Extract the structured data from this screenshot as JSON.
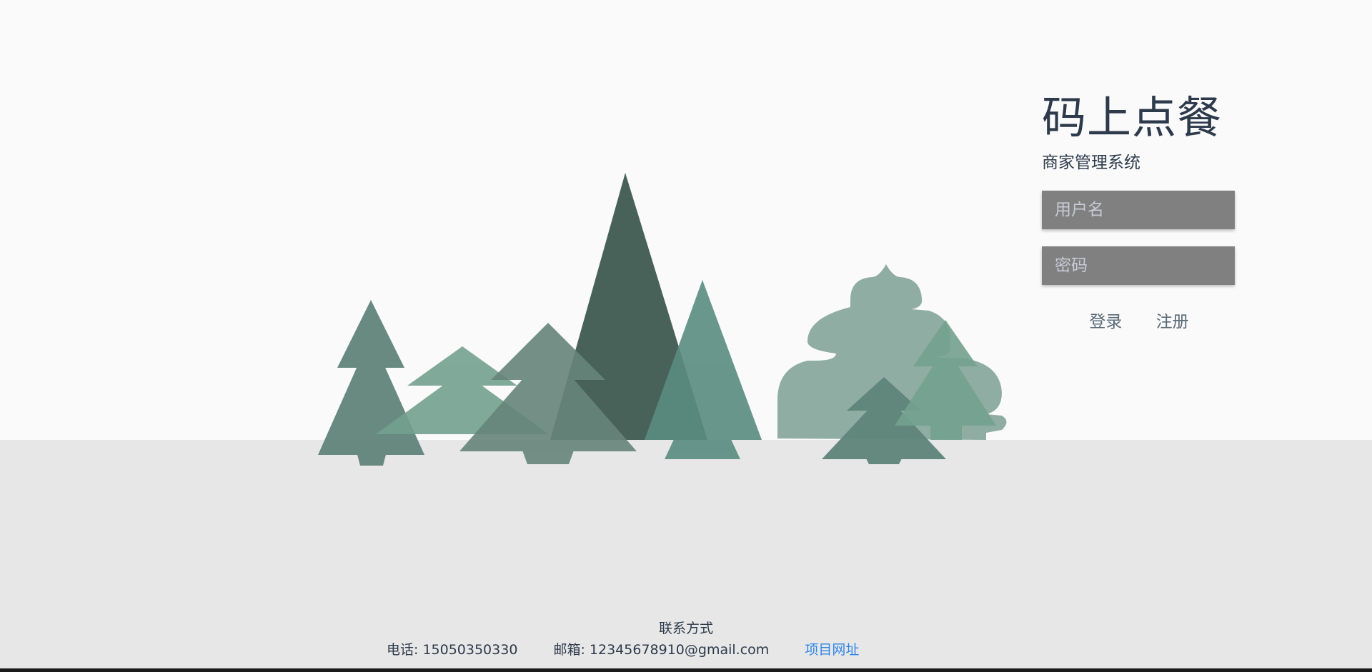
{
  "brand": {
    "title": "码上点餐",
    "subtitle": "商家管理系统"
  },
  "login": {
    "username_placeholder": "用户名",
    "password_placeholder": "密码",
    "login_label": "登录",
    "register_label": "注册"
  },
  "footer": {
    "title": "联系方式",
    "phone": "电话: 15050350330",
    "email": "邮箱: 12345678910@gmail.com",
    "project_link": "项目网址"
  },
  "colors": {
    "title_text": "#2d3a4b",
    "input_bg": "#808080",
    "link": "#2f85e6",
    "ground": "#e7e7e7",
    "sky": "#fafafa"
  },
  "illustration": {
    "icon": "forest-illustration"
  }
}
